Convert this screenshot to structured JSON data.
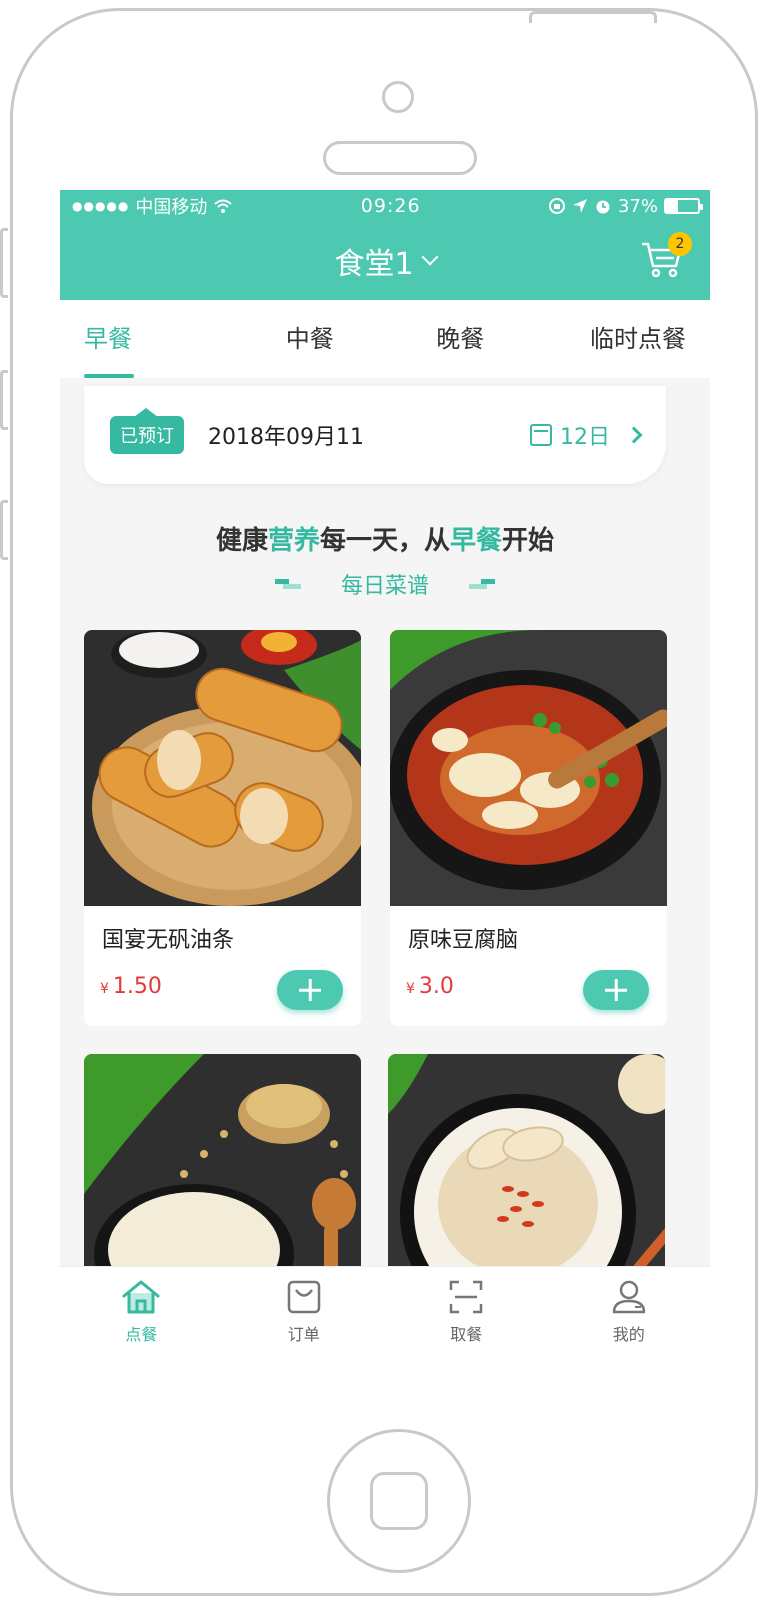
{
  "status_bar": {
    "signal": "●●●●●",
    "carrier": "中国移动",
    "time": "09:26",
    "battery": "37%",
    "battery_level": 0.37
  },
  "header": {
    "title": "食堂1",
    "cart_count": "2"
  },
  "tabs": [
    {
      "label": "早餐",
      "active": true
    },
    {
      "label": "中餐",
      "active": false
    },
    {
      "label": "晚餐",
      "active": false
    },
    {
      "label": "临时点餐",
      "active": false
    }
  ],
  "date_card": {
    "badge": "已预订",
    "date": "2018年09月11",
    "day": "12日"
  },
  "slogan": {
    "part1": "健康",
    "part2": "营养",
    "part3": "每一天，从",
    "part4": "早餐",
    "part5": "开始"
  },
  "subtitle": "每日菜谱",
  "menu_items": [
    {
      "name": "国宴无矾油条",
      "currency": "¥",
      "price": "1.50"
    },
    {
      "name": "原味豆腐脑",
      "currency": "¥",
      "price": "3.0"
    },
    {
      "name": "",
      "currency": "",
      "price": ""
    },
    {
      "name": "",
      "currency": "",
      "price": ""
    }
  ],
  "tabbar": [
    {
      "label": "点餐",
      "icon": "home-icon",
      "active": true
    },
    {
      "label": "订单",
      "icon": "bag-icon",
      "active": false
    },
    {
      "label": "取餐",
      "icon": "scan-icon",
      "active": false
    },
    {
      "label": "我的",
      "icon": "user-icon",
      "active": false
    }
  ],
  "colors": {
    "accent": "#4cc9b0",
    "accent_dark": "#35b9a1",
    "price": "#e4393c",
    "badge": "#ffc400"
  }
}
